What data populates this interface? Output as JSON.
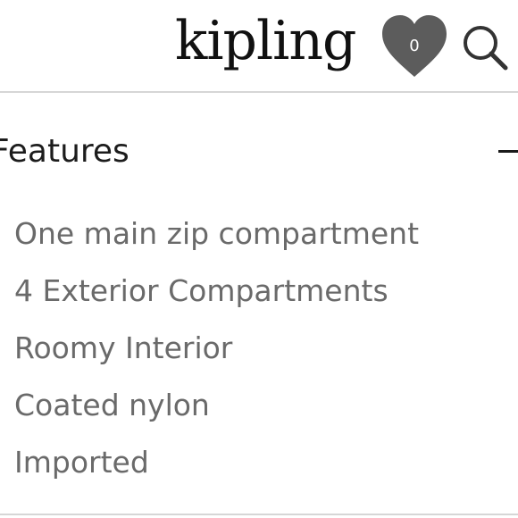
{
  "header": {
    "brand": "kipling",
    "wishlist_count": "0"
  },
  "icons": {
    "wishlist": "heart-icon",
    "search": "search-icon",
    "collapse": "minus-icon"
  },
  "colors": {
    "heart_fill": "#5c5c5c",
    "text_primary": "#1c1c1c",
    "text_secondary": "#6a6a6a",
    "divider": "#d6d6d6"
  },
  "features": {
    "title": "Features",
    "items": [
      "One main zip compartment",
      "4 Exterior Compartments",
      "Roomy Interior",
      "Coated nylon",
      "Imported"
    ]
  }
}
